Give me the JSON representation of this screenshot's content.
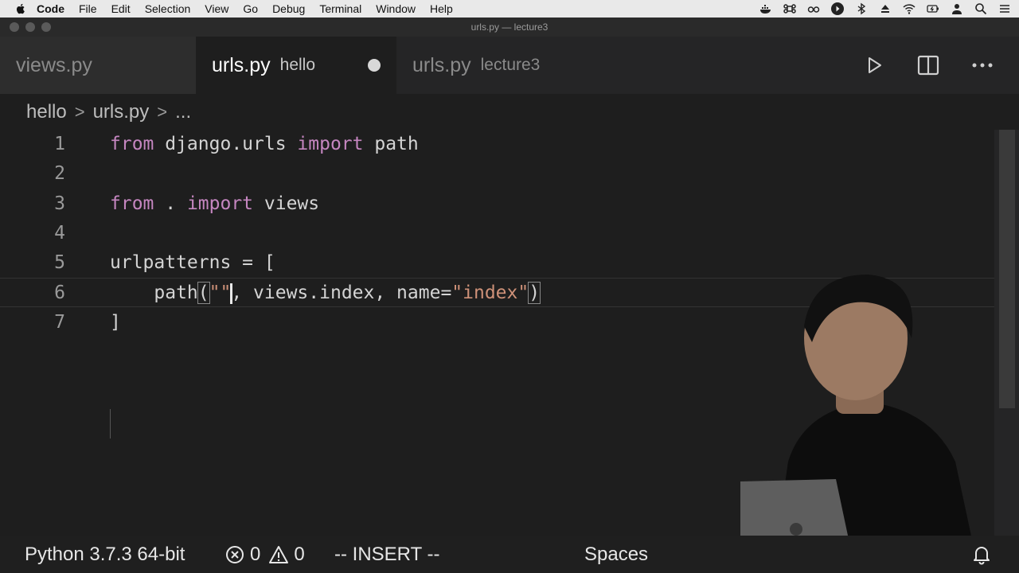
{
  "menubar": {
    "apple_icon": "apple-icon",
    "items": [
      "Code",
      "File",
      "Edit",
      "Selection",
      "View",
      "Go",
      "Debug",
      "Terminal",
      "Window",
      "Help"
    ]
  },
  "window": {
    "title": "urls.py — lecture3"
  },
  "tabs": [
    {
      "file": "views.py",
      "desc": ""
    },
    {
      "file": "urls.py",
      "desc": "hello",
      "dirty": true
    },
    {
      "file": "urls.py",
      "desc": "lecture3"
    }
  ],
  "breadcrumb": [
    "hello",
    "urls.py",
    "..."
  ],
  "editor": {
    "line_numbers": [
      "1",
      "2",
      "3",
      "4",
      "5",
      "6",
      "7"
    ],
    "lines": [
      [
        {
          "t": "from",
          "c": "kw"
        },
        {
          "t": " django.urls ",
          "c": ""
        },
        {
          "t": "import",
          "c": "kw"
        },
        {
          "t": " path",
          "c": ""
        }
      ],
      [],
      [
        {
          "t": "from",
          "c": "kw"
        },
        {
          "t": " . ",
          "c": ""
        },
        {
          "t": "import",
          "c": "kw"
        },
        {
          "t": " views",
          "c": ""
        }
      ],
      [],
      [
        {
          "t": "urlpatterns = [",
          "c": ""
        }
      ],
      [
        {
          "t": "    path",
          "c": ""
        },
        {
          "t": "(",
          "c": "bracket"
        },
        {
          "t": "\"\"",
          "c": "str"
        },
        {
          "t": "|",
          "c": "cursor"
        },
        {
          "t": ", views.index, name=",
          "c": ""
        },
        {
          "t": "\"index\"",
          "c": "str"
        },
        {
          "t": ")",
          "c": "bracket"
        }
      ],
      [
        {
          "t": "]",
          "c": ""
        }
      ]
    ]
  },
  "statusbar": {
    "python": "Python 3.7.3 64-bit",
    "errors": "0",
    "warnings": "0",
    "mode": "-- INSERT --",
    "spaces": "Spaces"
  },
  "colors": {
    "editor_bg": "#1e1e1e",
    "keyword": "#c586c0",
    "string": "#ce9178",
    "text": "#d4d4d4"
  }
}
